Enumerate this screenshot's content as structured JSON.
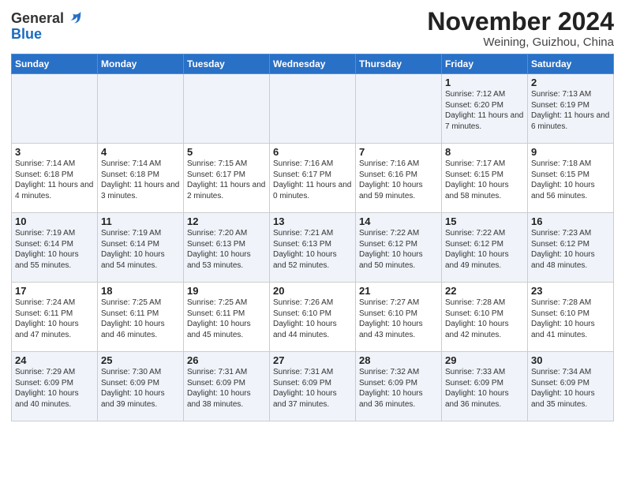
{
  "header": {
    "logo_general": "General",
    "logo_blue": "Blue",
    "month_title": "November 2024",
    "subtitle": "Weining, Guizhou, China"
  },
  "weekdays": [
    "Sunday",
    "Monday",
    "Tuesday",
    "Wednesday",
    "Thursday",
    "Friday",
    "Saturday"
  ],
  "weeks": [
    [
      {
        "day": "",
        "info": ""
      },
      {
        "day": "",
        "info": ""
      },
      {
        "day": "",
        "info": ""
      },
      {
        "day": "",
        "info": ""
      },
      {
        "day": "",
        "info": ""
      },
      {
        "day": "1",
        "info": "Sunrise: 7:12 AM\nSunset: 6:20 PM\nDaylight: 11 hours\nand 7 minutes."
      },
      {
        "day": "2",
        "info": "Sunrise: 7:13 AM\nSunset: 6:19 PM\nDaylight: 11 hours\nand 6 minutes."
      }
    ],
    [
      {
        "day": "3",
        "info": "Sunrise: 7:14 AM\nSunset: 6:18 PM\nDaylight: 11 hours\nand 4 minutes."
      },
      {
        "day": "4",
        "info": "Sunrise: 7:14 AM\nSunset: 6:18 PM\nDaylight: 11 hours\nand 3 minutes."
      },
      {
        "day": "5",
        "info": "Sunrise: 7:15 AM\nSunset: 6:17 PM\nDaylight: 11 hours\nand 2 minutes."
      },
      {
        "day": "6",
        "info": "Sunrise: 7:16 AM\nSunset: 6:17 PM\nDaylight: 11 hours\nand 0 minutes."
      },
      {
        "day": "7",
        "info": "Sunrise: 7:16 AM\nSunset: 6:16 PM\nDaylight: 10 hours\nand 59 minutes."
      },
      {
        "day": "8",
        "info": "Sunrise: 7:17 AM\nSunset: 6:15 PM\nDaylight: 10 hours\nand 58 minutes."
      },
      {
        "day": "9",
        "info": "Sunrise: 7:18 AM\nSunset: 6:15 PM\nDaylight: 10 hours\nand 56 minutes."
      }
    ],
    [
      {
        "day": "10",
        "info": "Sunrise: 7:19 AM\nSunset: 6:14 PM\nDaylight: 10 hours\nand 55 minutes."
      },
      {
        "day": "11",
        "info": "Sunrise: 7:19 AM\nSunset: 6:14 PM\nDaylight: 10 hours\nand 54 minutes."
      },
      {
        "day": "12",
        "info": "Sunrise: 7:20 AM\nSunset: 6:13 PM\nDaylight: 10 hours\nand 53 minutes."
      },
      {
        "day": "13",
        "info": "Sunrise: 7:21 AM\nSunset: 6:13 PM\nDaylight: 10 hours\nand 52 minutes."
      },
      {
        "day": "14",
        "info": "Sunrise: 7:22 AM\nSunset: 6:12 PM\nDaylight: 10 hours\nand 50 minutes."
      },
      {
        "day": "15",
        "info": "Sunrise: 7:22 AM\nSunset: 6:12 PM\nDaylight: 10 hours\nand 49 minutes."
      },
      {
        "day": "16",
        "info": "Sunrise: 7:23 AM\nSunset: 6:12 PM\nDaylight: 10 hours\nand 48 minutes."
      }
    ],
    [
      {
        "day": "17",
        "info": "Sunrise: 7:24 AM\nSunset: 6:11 PM\nDaylight: 10 hours\nand 47 minutes."
      },
      {
        "day": "18",
        "info": "Sunrise: 7:25 AM\nSunset: 6:11 PM\nDaylight: 10 hours\nand 46 minutes."
      },
      {
        "day": "19",
        "info": "Sunrise: 7:25 AM\nSunset: 6:11 PM\nDaylight: 10 hours\nand 45 minutes."
      },
      {
        "day": "20",
        "info": "Sunrise: 7:26 AM\nSunset: 6:10 PM\nDaylight: 10 hours\nand 44 minutes."
      },
      {
        "day": "21",
        "info": "Sunrise: 7:27 AM\nSunset: 6:10 PM\nDaylight: 10 hours\nand 43 minutes."
      },
      {
        "day": "22",
        "info": "Sunrise: 7:28 AM\nSunset: 6:10 PM\nDaylight: 10 hours\nand 42 minutes."
      },
      {
        "day": "23",
        "info": "Sunrise: 7:28 AM\nSunset: 6:10 PM\nDaylight: 10 hours\nand 41 minutes."
      }
    ],
    [
      {
        "day": "24",
        "info": "Sunrise: 7:29 AM\nSunset: 6:09 PM\nDaylight: 10 hours\nand 40 minutes."
      },
      {
        "day": "25",
        "info": "Sunrise: 7:30 AM\nSunset: 6:09 PM\nDaylight: 10 hours\nand 39 minutes."
      },
      {
        "day": "26",
        "info": "Sunrise: 7:31 AM\nSunset: 6:09 PM\nDaylight: 10 hours\nand 38 minutes."
      },
      {
        "day": "27",
        "info": "Sunrise: 7:31 AM\nSunset: 6:09 PM\nDaylight: 10 hours\nand 37 minutes."
      },
      {
        "day": "28",
        "info": "Sunrise: 7:32 AM\nSunset: 6:09 PM\nDaylight: 10 hours\nand 36 minutes."
      },
      {
        "day": "29",
        "info": "Sunrise: 7:33 AM\nSunset: 6:09 PM\nDaylight: 10 hours\nand 36 minutes."
      },
      {
        "day": "30",
        "info": "Sunrise: 7:34 AM\nSunset: 6:09 PM\nDaylight: 10 hours\nand 35 minutes."
      }
    ]
  ]
}
